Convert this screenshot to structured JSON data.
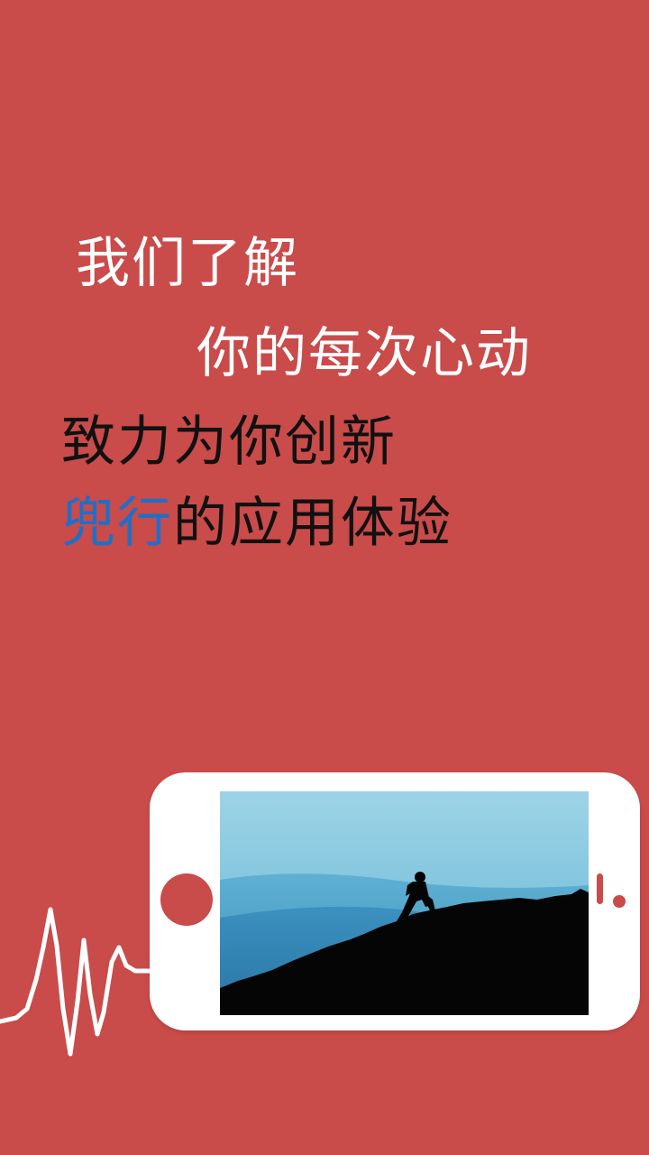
{
  "colors": {
    "background": "#c94b4a",
    "headline_light": "#ffffff",
    "headline_dark": "#111111",
    "accent": "#1f6fc8"
  },
  "headline": {
    "line1": "我们了解",
    "line2": "你的每次心动",
    "line3": "致力为你创新",
    "line4_accent": "兜行",
    "line4_rest": "的应用体验"
  },
  "illustration": {
    "device": "phone-landscape",
    "screen_image": "mountain-climber-silhouette",
    "decoration": "heartbeat-line"
  }
}
